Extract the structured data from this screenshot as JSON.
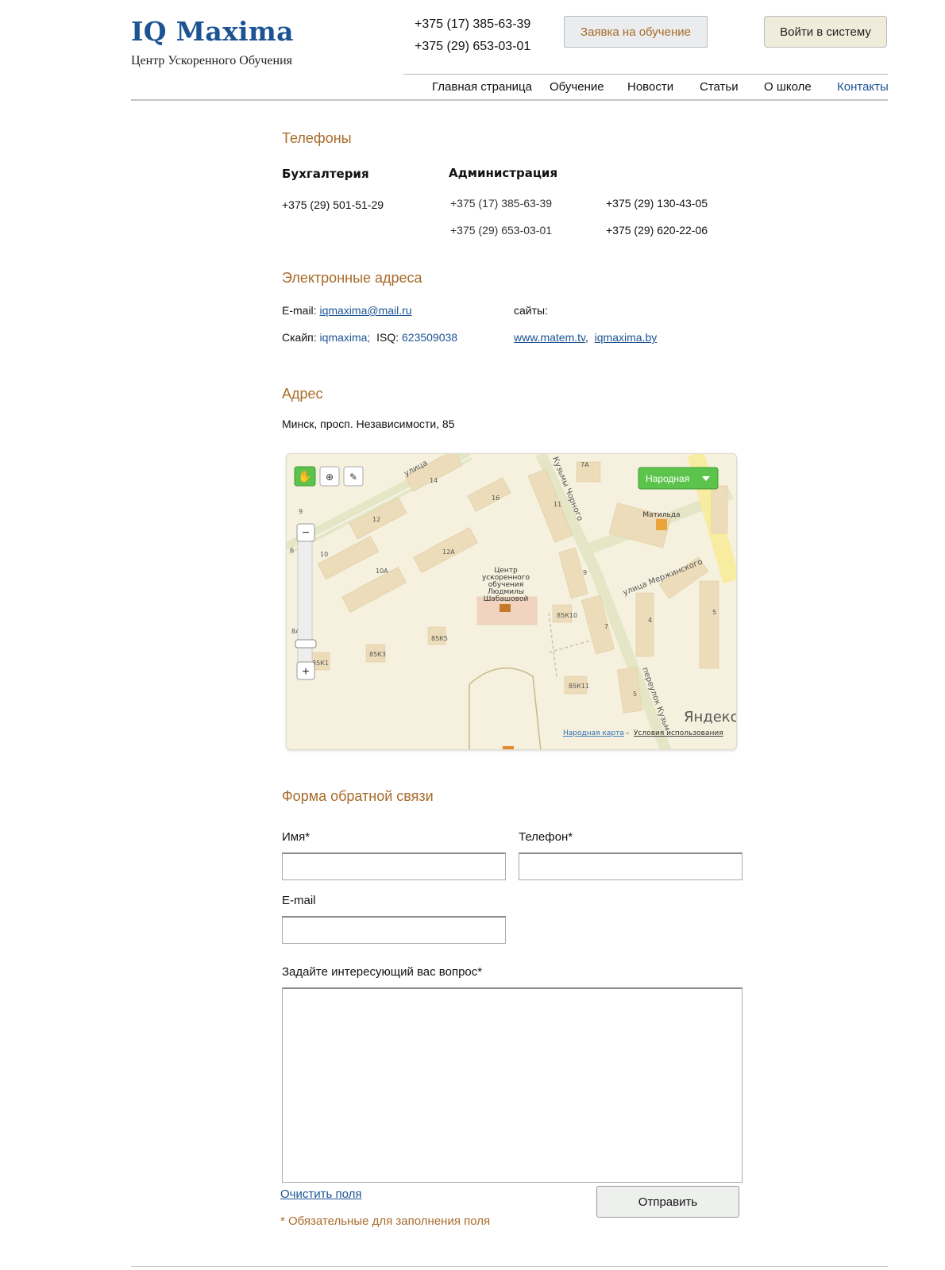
{
  "header": {
    "logo_title": "IQ Maxima",
    "logo_subtitle": "Центр Ускоренного Обучения",
    "phones": [
      "+375 (17) 385-63-39",
      "+375 (29) 653-03-01"
    ],
    "apply_button": "Заявка на обучение",
    "login_button": "Войти в систему"
  },
  "nav": {
    "items": [
      "Главная страница",
      "Обучение",
      "Новости",
      "Статьи",
      "О школе",
      "Контакты"
    ],
    "active": "Контакты"
  },
  "phones_section": {
    "title": "Телефоны",
    "accounting": {
      "label": "Бухгалтерия",
      "phone": "+375 (29) 501-51-29"
    },
    "administration": {
      "label": "Администрация",
      "col1": [
        "+375 (17) 385-63-39",
        "+375 (29) 653-03-01"
      ],
      "col2": [
        "+375 (29) 130-43-05",
        "+375 (29) 620-22-06"
      ]
    }
  },
  "email_section": {
    "title": "Электронные адреса",
    "email_label": "E-mail:",
    "email": "iqmaxima@mail.ru",
    "skype_label": "Скайп:",
    "skype": "iqmaxima;",
    "isq_label": "ISQ:",
    "isq": "623509038",
    "sites_label": "сайты:",
    "site1": "www.matem.tv",
    "site_sep": ",",
    "site2": "iqmaxima.by"
  },
  "address_section": {
    "title": "Адрес",
    "address": "Минск, просп. Независимости, 85"
  },
  "map": {
    "layer_button": "Народная",
    "poi_label": [
      "Центр",
      "ускоренного",
      "обучения",
      "Людмилы",
      "Шабашовой"
    ],
    "poi_matilda": "Матильда",
    "streets": [
      "улица",
      "улица Мержинского",
      "переулок Кузьм",
      "Кузьмы Чорного"
    ],
    "numbers": [
      "14",
      "16",
      "11",
      "7А",
      "9",
      "12",
      "12А",
      "10",
      "10А",
      "9",
      "8А",
      "85К10",
      "85К5",
      "85К3",
      "85К1",
      "7",
      "4",
      "5",
      "85К11",
      "5",
      "6"
    ],
    "brand": "Яндекс",
    "footer_link1": "Народная карта",
    "footer_sep": " – ",
    "footer_link2": "Условия использования",
    "colors": {
      "road": "#e4e6c6",
      "building": "#ecdcb9",
      "main_road": "#f7eca0",
      "button_green": "#5cc44c"
    }
  },
  "form": {
    "title": "Форма обратной связи",
    "name_label": "Имя*",
    "phone_label": "Телефон*",
    "email_label": "E-mail",
    "question_label": "Задайте интересующий вас вопрос*",
    "clear_label": "Очистить поля",
    "submit_label": "Отправить",
    "required_note": "* Обязательные для заполнения поля",
    "name_value": "",
    "phone_value": "",
    "email_value": "",
    "question_value": ""
  }
}
